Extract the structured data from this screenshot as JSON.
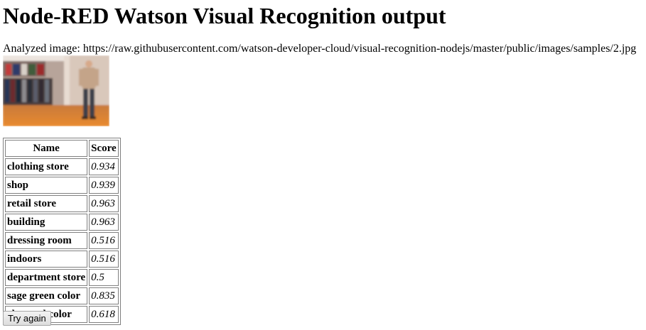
{
  "page": {
    "title": "Node-RED Watson Visual Recognition output",
    "analyzed_label": "Analyzed image: https://raw.githubusercontent.com/watson-developer-cloud/visual-recognition-nodejs/master/public/images/samples/2.jpg"
  },
  "image": {
    "description": "Blurred photo of a man standing in a clothing store"
  },
  "table": {
    "headers": [
      "Name",
      "Score"
    ],
    "rows": [
      {
        "name": "clothing store",
        "score": "0.934"
      },
      {
        "name": "shop",
        "score": "0.939"
      },
      {
        "name": "retail store",
        "score": "0.963"
      },
      {
        "name": "building",
        "score": "0.963"
      },
      {
        "name": "dressing room",
        "score": "0.516"
      },
      {
        "name": "indoors",
        "score": "0.516"
      },
      {
        "name": "department store",
        "score": "0.5"
      },
      {
        "name": "sage green color",
        "score": "0.835"
      },
      {
        "name": "charcoal color",
        "score": "0.618"
      }
    ]
  },
  "actions": {
    "try_again_label": "Try again"
  }
}
